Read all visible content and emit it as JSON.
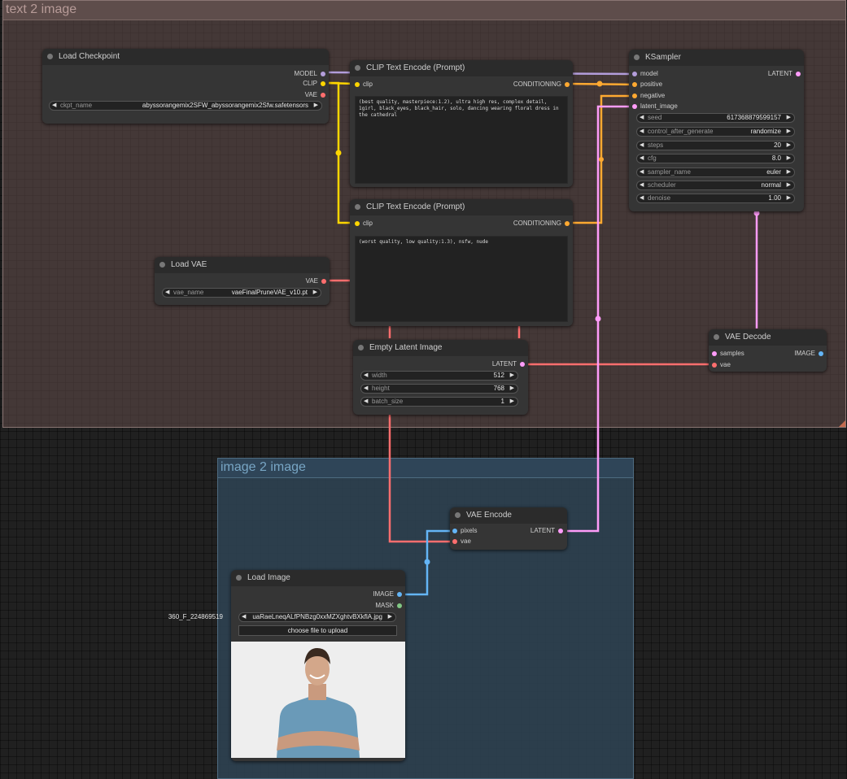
{
  "groups": {
    "text2image": "text 2 image",
    "image2image": "image 2 image"
  },
  "load_checkpoint": {
    "title": "Load Checkpoint",
    "out_model": "MODEL",
    "out_clip": "CLIP",
    "out_vae": "VAE",
    "ckpt_label": "ckpt_name",
    "ckpt_value": "abyssorangemix2SFW_abyssorangemix2Sfw.safetensors"
  },
  "clip_pos": {
    "title": "CLIP Text Encode (Prompt)",
    "in_clip": "clip",
    "out": "CONDITIONING",
    "text": "(best quality, masterpiece:1.2), ultra high res, complex detail, 1girl, black_eyes, black_hair, solo, dancing wearing floral dress in the cathedral"
  },
  "clip_neg": {
    "title": "CLIP Text Encode (Prompt)",
    "in_clip": "clip",
    "out": "CONDITIONING",
    "text": "(worst quality, low quality:1.3), nsfw, nude"
  },
  "ksampler": {
    "title": "KSampler",
    "in_model": "model",
    "in_positive": "positive",
    "in_negative": "negative",
    "in_latent": "latent_image",
    "out": "LATENT",
    "widgets": [
      {
        "label": "seed",
        "value": "617368879599157"
      },
      {
        "label": "control_after_generate",
        "value": "randomize"
      },
      {
        "label": "steps",
        "value": "20"
      },
      {
        "label": "cfg",
        "value": "8.0"
      },
      {
        "label": "sampler_name",
        "value": "euler"
      },
      {
        "label": "scheduler",
        "value": "normal"
      },
      {
        "label": "denoise",
        "value": "1.00"
      }
    ]
  },
  "load_vae": {
    "title": "Load VAE",
    "out": "VAE",
    "label": "vae_name",
    "value": "vaeFinalPruneVAE_v10.pt"
  },
  "empty_latent": {
    "title": "Empty Latent Image",
    "out": "LATENT",
    "widgets": [
      {
        "label": "width",
        "value": "512"
      },
      {
        "label": "height",
        "value": "768"
      },
      {
        "label": "batch_size",
        "value": "1"
      }
    ]
  },
  "vae_decode": {
    "title": "VAE Decode",
    "in_samples": "samples",
    "in_vae": "vae",
    "out": "IMAGE"
  },
  "vae_encode": {
    "title": "VAE Encode",
    "in_pixels": "pixels",
    "in_vae": "vae",
    "out": "LATENT"
  },
  "load_image": {
    "title": "Load Image",
    "out_image": "IMAGE",
    "out_mask": "MASK",
    "file_prefix": "360_F_224869519",
    "file_name": "uaRaeLneqALfPNBzg0xxMZXghtvBXkflA.jpg",
    "upload_label": "choose file to upload"
  },
  "colors": {
    "model": "#b39ddb",
    "clip": "#ffd500",
    "vae": "#ff6e6e",
    "conditioning": "#ffa931",
    "latent": "#ff9cf9",
    "image": "#64b5f6",
    "mask": "#81c784",
    "group1": "#624c4a",
    "group2": "#2f4455"
  }
}
